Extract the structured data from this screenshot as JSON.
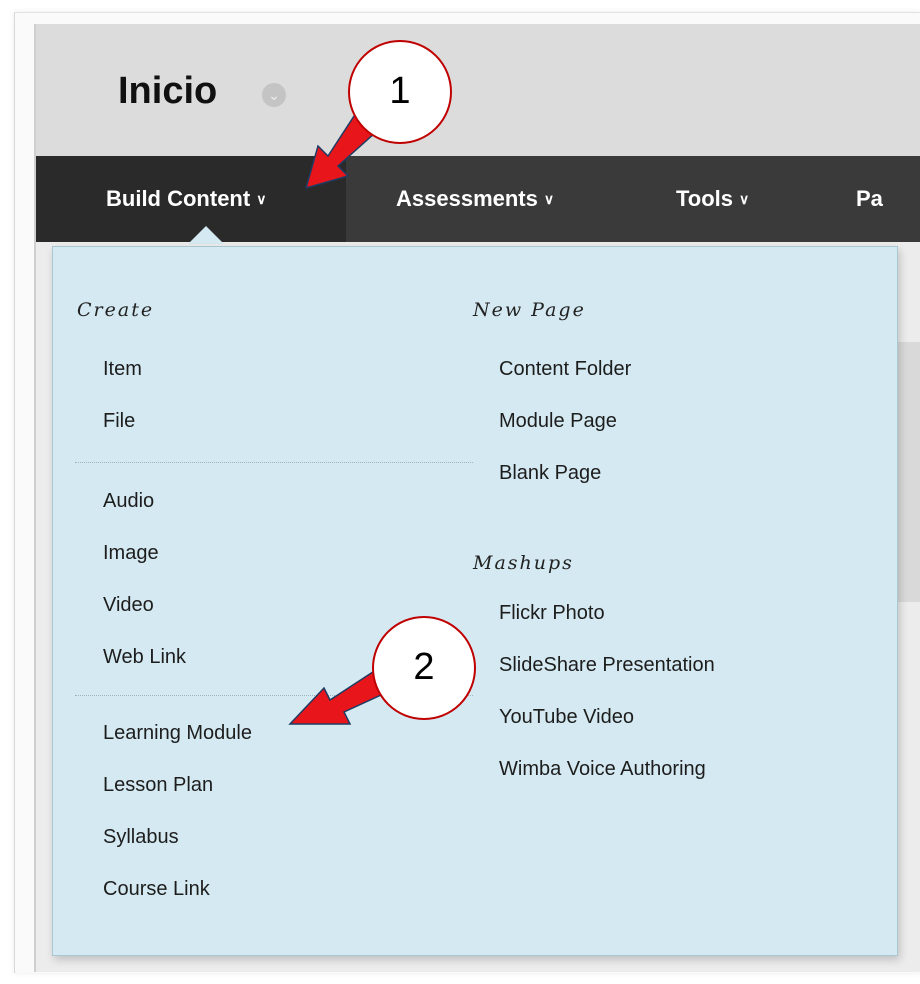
{
  "header": {
    "title": "Inicio",
    "title_menu_icon": "chevron-down-icon"
  },
  "navbar": {
    "tabs": [
      {
        "label": "Build Content",
        "active": true
      },
      {
        "label": "Assessments",
        "active": false
      },
      {
        "label": "Tools",
        "active": false
      },
      {
        "label": "Pa",
        "active": false
      }
    ],
    "caret_icon": "chevron-down-icon"
  },
  "menu": {
    "create": {
      "heading": "Create",
      "items": [
        "Item",
        "File",
        "Audio",
        "Image",
        "Video",
        "Web Link",
        "Learning Module",
        "Lesson Plan",
        "Syllabus",
        "Course Link"
      ]
    },
    "new_page": {
      "heading": "New Page",
      "items": [
        "Content Folder",
        "Module Page",
        "Blank Page"
      ]
    },
    "mashups": {
      "heading": "Mashups",
      "items": [
        "Flickr Photo",
        "SlideShare Presentation",
        "YouTube Video",
        "Wimba Voice Authoring"
      ]
    }
  },
  "callouts": [
    "1",
    "2"
  ],
  "colors": {
    "menu_bg": "#d4e9f1",
    "navbar": "#3a3a3a",
    "callout_border": "#c00000",
    "arrow": "#e8161b"
  }
}
